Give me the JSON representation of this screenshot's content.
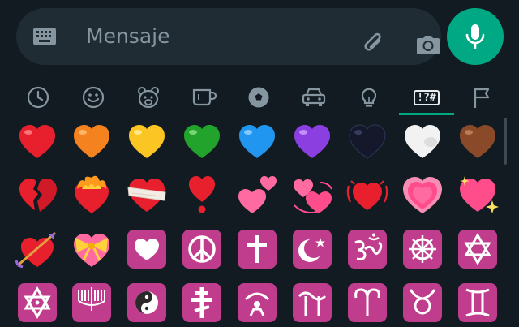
{
  "composer": {
    "placeholder": "Mensaje",
    "icons": [
      "keyboard-icon",
      "attach-icon",
      "camera-icon",
      "mic-icon"
    ],
    "accent": "#00a884"
  },
  "tabs": [
    {
      "name": "recent",
      "icon": "clock-icon"
    },
    {
      "name": "smileys",
      "icon": "smiley-icon"
    },
    {
      "name": "animals",
      "icon": "bear-icon"
    },
    {
      "name": "food",
      "icon": "cup-icon"
    },
    {
      "name": "activities",
      "icon": "soccer-icon"
    },
    {
      "name": "travel",
      "icon": "car-icon"
    },
    {
      "name": "objects",
      "icon": "bulb-icon"
    },
    {
      "name": "symbols",
      "icon": "symbols-icon",
      "label": "!?#",
      "selected": true
    },
    {
      "name": "flags",
      "icon": "flag-icon"
    }
  ],
  "emoji_rows": [
    [
      "red-heart",
      "orange-heart",
      "yellow-heart",
      "green-heart",
      "blue-heart",
      "purple-heart",
      "black-heart",
      "white-heart",
      "brown-heart"
    ],
    [
      "broken-heart",
      "heart-on-fire",
      "mending-heart",
      "heart-exclamation",
      "two-hearts",
      "revolving-hearts",
      "beating-heart",
      "growing-heart",
      "sparkling-heart"
    ],
    [
      "heart-with-arrow",
      "heart-with-ribbon",
      "heart-decoration",
      "peace-symbol",
      "latin-cross",
      "star-and-crescent",
      "om",
      "wheel-of-dharma",
      "star-of-david"
    ],
    [
      "dotted-six-pointed-star",
      "menorah",
      "yin-yang",
      "orthodox-cross",
      "place-of-worship",
      "ophiuchus",
      "aries",
      "taurus",
      "gemini"
    ]
  ]
}
